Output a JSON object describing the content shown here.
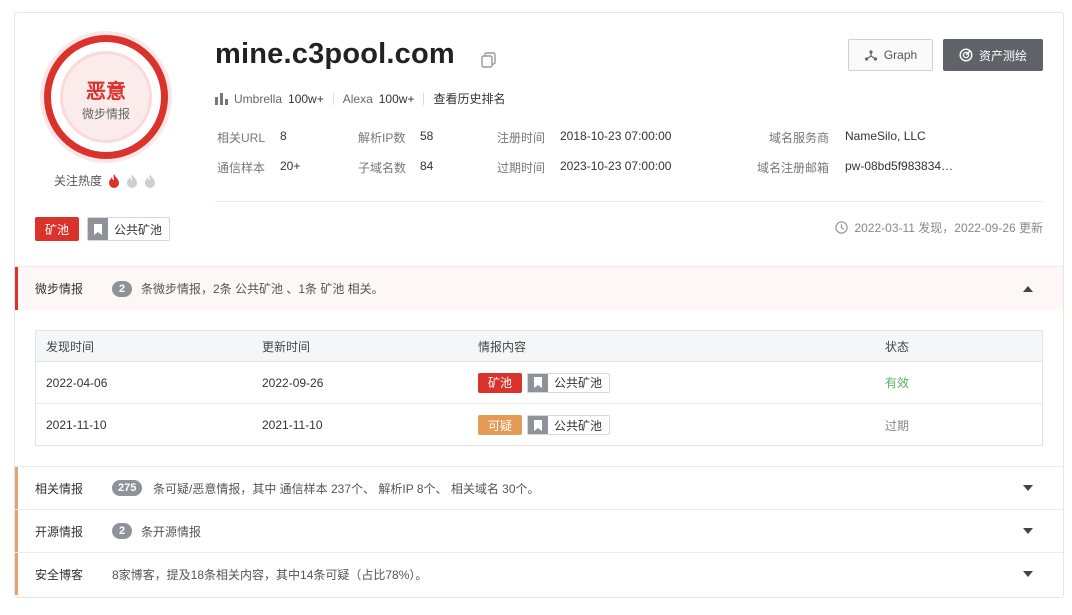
{
  "verdict": {
    "label": "恶意",
    "sub": "微步情报"
  },
  "heat": {
    "label": "关注热度",
    "level": 1,
    "max": 3
  },
  "domain": "mine.c3pool.com",
  "rank": {
    "umbrella_label": "Umbrella",
    "umbrella_value": "100w+",
    "alexa_label": "Alexa",
    "alexa_value": "100w+",
    "history_link": "查看历史排名"
  },
  "meta": [
    {
      "k": "相关URL",
      "v": "8"
    },
    {
      "k": "解析IP数",
      "v": "58"
    },
    {
      "k": "注册时间",
      "v": "2018-10-23 07:00:00"
    },
    {
      "k": "域名服务商",
      "v": "NameSilo, LLC"
    },
    {
      "k": "通信样本",
      "v": "20+"
    },
    {
      "k": "子域名数",
      "v": "84"
    },
    {
      "k": "过期时间",
      "v": "2023-10-23 07:00:00"
    },
    {
      "k": "域名注册邮箱",
      "v": "pw-08bd5f983834…"
    }
  ],
  "buttons": {
    "graph": "Graph",
    "asset": "资产测绘"
  },
  "tags": {
    "mining": "矿池",
    "public": "公共矿池"
  },
  "timeinfo": "2022-03-11 发现，2022-09-26 更新",
  "intel": {
    "title": "微步情报",
    "count": "2",
    "desc": "条微步情报，2条 公共矿池 、1条 矿池 相关。",
    "columns": [
      "发现时间",
      "更新时间",
      "情报内容",
      "状态"
    ],
    "rows": [
      {
        "found": "2022-04-06",
        "updated": "2022-09-26",
        "tag": "矿池",
        "pub": "公共矿池",
        "status": "有效"
      },
      {
        "found": "2021-11-10",
        "updated": "2021-11-10",
        "tag": "可疑",
        "pub": "公共矿池",
        "status": "过期"
      }
    ]
  },
  "related": {
    "title": "相关情报",
    "count": "275",
    "desc": "条可疑/恶意情报，其中 通信样本 237个、 解析IP 8个、 相关域名 30个。"
  },
  "opensource": {
    "title": "开源情报",
    "count": "2",
    "desc": "条开源情报"
  },
  "blog": {
    "title": "安全博客",
    "desc": "8家博客，提及18条相关内容，其中14条可疑（占比78%）。"
  },
  "colors": {
    "malicious": "#d9332c",
    "suspicious": "#e49b55",
    "valid": "#58b35e",
    "neutral_bar": "#e4a36c"
  }
}
